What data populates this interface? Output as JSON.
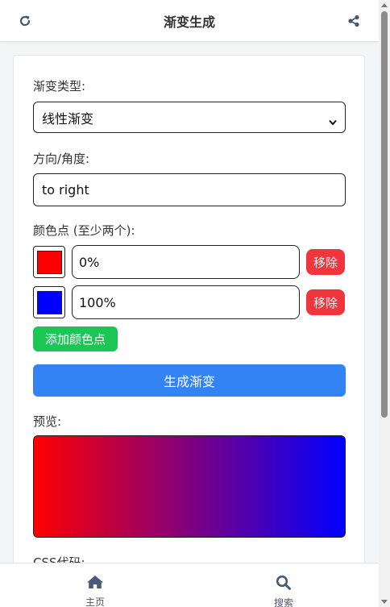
{
  "header": {
    "title": "渐变生成"
  },
  "form": {
    "type_label": "渐变类型:",
    "type_value": "线性渐变",
    "direction_label": "方向/角度:",
    "direction_value": "to right",
    "stops_label": "颜色点 (至少两个):",
    "stops": [
      {
        "color": "#ff0000",
        "position": "0%",
        "remove_label": "移除"
      },
      {
        "color": "#0000ff",
        "position": "100%",
        "remove_label": "移除"
      }
    ],
    "add_label": "添加颜色点",
    "generate_label": "生成渐变",
    "preview_label": "预览:",
    "css_label": "CSS代码:"
  },
  "nav": {
    "home_label": "主页",
    "search_label": "搜索"
  },
  "colors": {
    "accent_blue": "#3383f5",
    "remove_red": "#f0353d",
    "add_green": "#1cc654",
    "nav_icon": "#4a5a78"
  }
}
